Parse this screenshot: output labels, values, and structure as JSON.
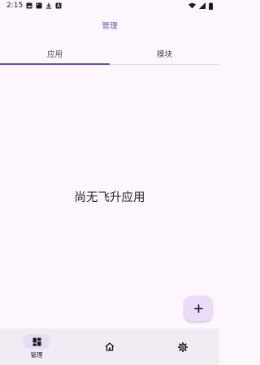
{
  "status_bar": {
    "time": "2:15",
    "left_icons": [
      "photo-icon",
      "image-icon",
      "download-icon",
      "translate-icon"
    ],
    "right_icons": [
      "wifi-icon",
      "signal-icon",
      "battery-icon"
    ]
  },
  "app_bar": {
    "title": "管理"
  },
  "tabs": [
    {
      "label": "应用",
      "active": true
    },
    {
      "label": "模块",
      "active": false
    }
  ],
  "main": {
    "empty_text": "尚无飞升应用"
  },
  "fab": {
    "icon": "plus-icon"
  },
  "bottom_nav": {
    "items": [
      {
        "label": "管理",
        "icon": "dashboard-icon",
        "active": true
      },
      {
        "label": "",
        "icon": "home-icon",
        "active": false
      },
      {
        "label": "",
        "icon": "settings-icon",
        "active": false
      }
    ]
  },
  "colors": {
    "accent": "#6a4fa5",
    "background": "#fdf7fd",
    "fab_bg": "#ebdcf8",
    "nav_bg": "#f1ebf4",
    "pill_bg": "#e8ddf5"
  }
}
